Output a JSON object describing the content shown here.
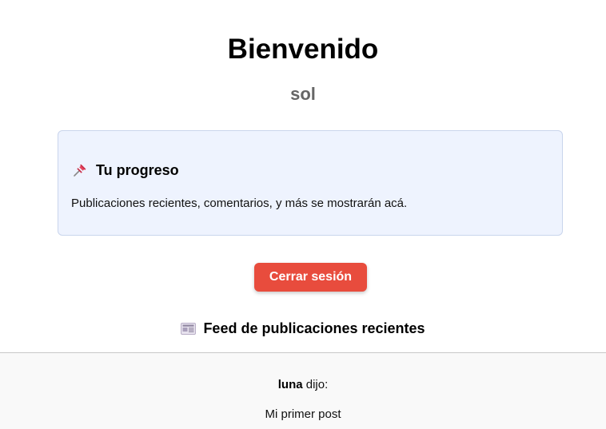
{
  "header": {
    "title": "Bienvenido",
    "username": "sol"
  },
  "progress": {
    "icon": "pushpin-icon",
    "heading": "Tu progreso",
    "text": "Publicaciones recientes, comentarios, y más se mostrarán acá.",
    "background_color": "#eef3fe"
  },
  "actions": {
    "logout_label": "Cerrar sesión",
    "logout_color": "#e84c3d"
  },
  "feed": {
    "icon": "newspaper-icon",
    "heading": "Feed de publicaciones recientes",
    "posts": [
      {
        "author": "luna",
        "verb": " dijo:",
        "content": "Mi primer post"
      }
    ]
  }
}
